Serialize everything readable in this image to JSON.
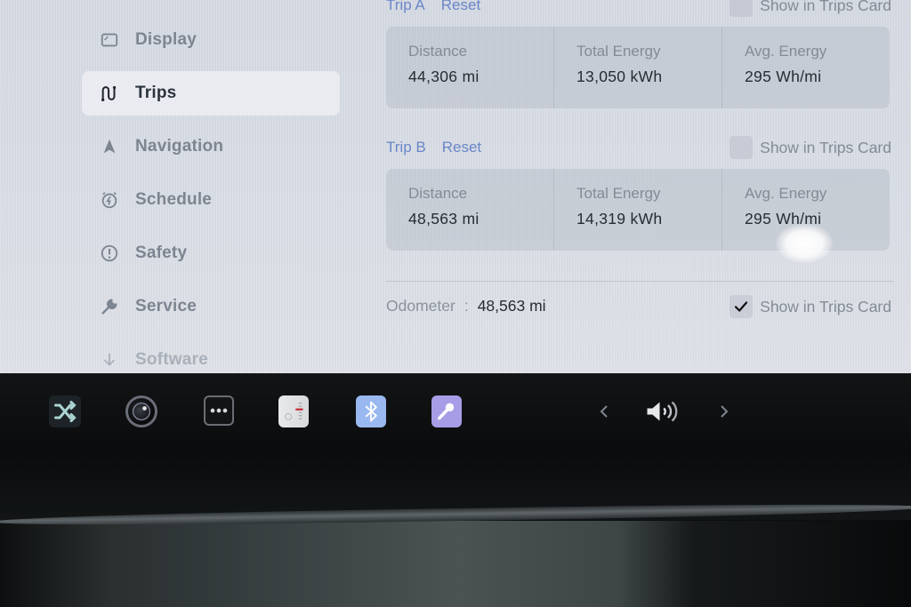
{
  "sidebar": {
    "items": [
      {
        "label": "Display",
        "icon": "display-icon",
        "active": false
      },
      {
        "label": "Trips",
        "icon": "trips-route-icon",
        "active": true
      },
      {
        "label": "Navigation",
        "icon": "navigation-arrow-icon",
        "active": false
      },
      {
        "label": "Schedule",
        "icon": "alarm-clock-bolt-icon",
        "active": false
      },
      {
        "label": "Safety",
        "icon": "exclamation-circle-icon",
        "active": false
      },
      {
        "label": "Service",
        "icon": "wrench-icon",
        "active": false
      },
      {
        "label": "Software",
        "icon": "download-arrow-icon",
        "active": false
      }
    ]
  },
  "trips": {
    "trip_a": {
      "name": "Trip A",
      "reset_label": "Reset",
      "show_label": "Show in Trips Card",
      "show_checked": false,
      "stats": [
        {
          "label": "Distance",
          "value": "44,306 mi"
        },
        {
          "label": "Total Energy",
          "value": "13,050 kWh"
        },
        {
          "label": "Avg. Energy",
          "value": "295 Wh/mi"
        }
      ]
    },
    "trip_b": {
      "name": "Trip B",
      "reset_label": "Reset",
      "show_label": "Show in Trips Card",
      "show_checked": false,
      "stats": [
        {
          "label": "Distance",
          "value": "48,563 mi"
        },
        {
          "label": "Total Energy",
          "value": "14,319 kWh"
        },
        {
          "label": "Avg. Energy",
          "value": "295 Wh/mi"
        }
      ]
    },
    "odometer": {
      "label": "Odometer",
      "separator": ":",
      "value": "48,563 mi",
      "show_label": "Show in Trips Card",
      "show_checked": true
    }
  },
  "dock": {
    "items": [
      {
        "name": "shuffle-icon"
      },
      {
        "name": "camera-icon"
      },
      {
        "name": "more-dots-icon"
      },
      {
        "name": "radio-tuner-icon"
      },
      {
        "name": "bluetooth-icon"
      },
      {
        "name": "microphone-icon"
      },
      {
        "name": "previous-chevron-icon"
      },
      {
        "name": "volume-icon"
      },
      {
        "name": "next-chevron-icon"
      }
    ]
  },
  "colors": {
    "link_blue": "#6b86c9",
    "active_text": "#2c333c",
    "muted_text": "#7d8591",
    "value_text": "#262c33",
    "bluetooth_tile": "#9ab8f0",
    "mic_tile": "#a79de6"
  }
}
